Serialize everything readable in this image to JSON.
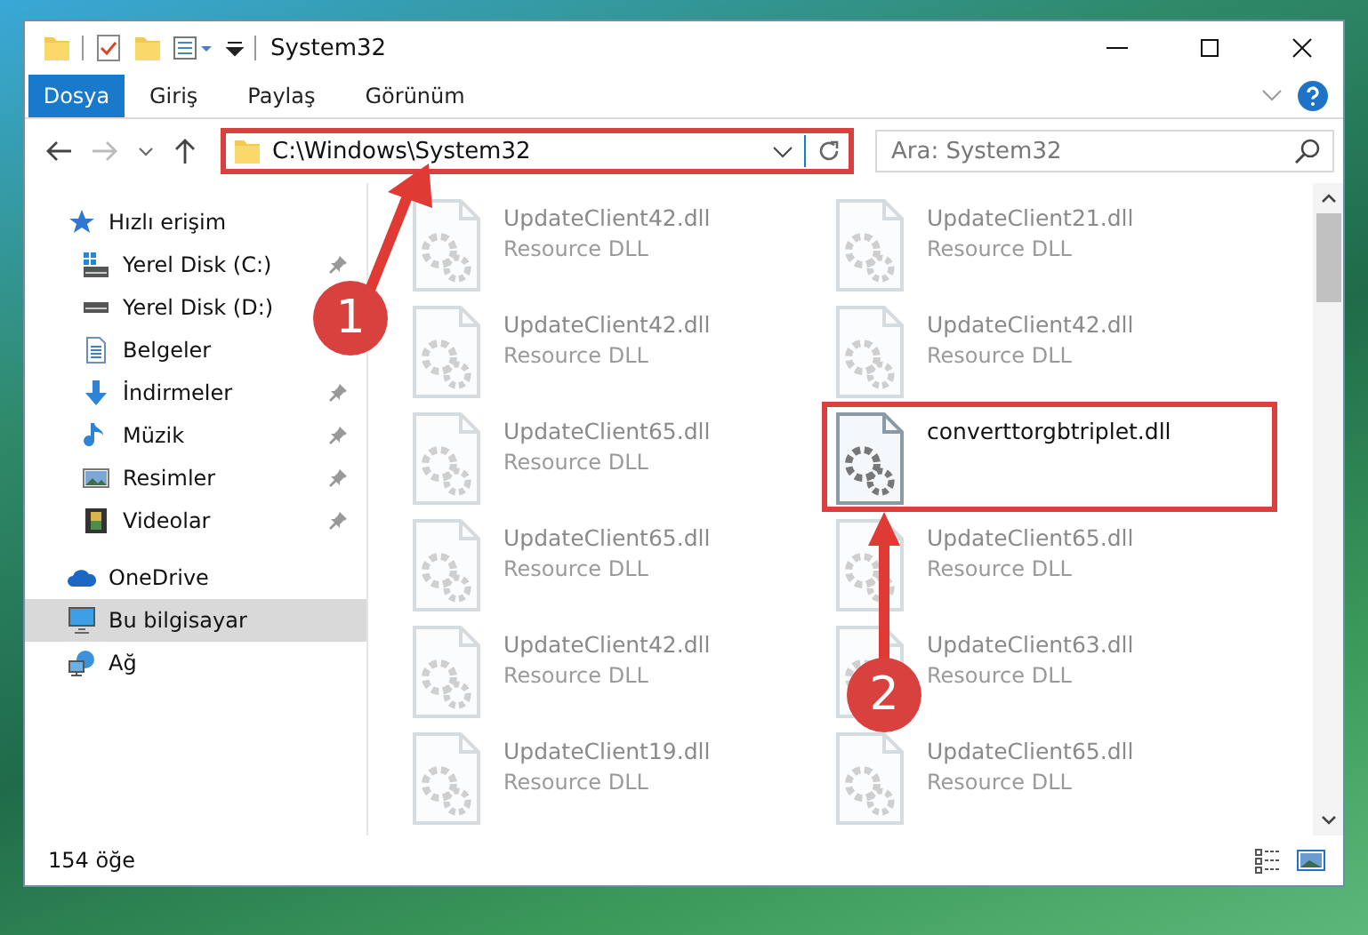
{
  "window": {
    "title": "System32"
  },
  "ribbon": {
    "tabs": [
      {
        "label": "Dosya",
        "kind": "file"
      },
      {
        "label": "Giriş",
        "kind": "tab"
      },
      {
        "label": "Paylaş",
        "kind": "tab"
      },
      {
        "label": "Görünüm",
        "kind": "tab"
      }
    ]
  },
  "address": {
    "path": "C:\\Windows\\System32",
    "highlighted": true
  },
  "search": {
    "placeholder": "Ara: System32"
  },
  "sidebar": {
    "items": [
      {
        "label": "Hızlı erişim",
        "selected": false,
        "children": [
          {
            "label": "Yerel Disk (C:)",
            "pinned": true,
            "selected": false
          },
          {
            "label": "Yerel Disk (D:)",
            "pinned": false,
            "selected": false
          },
          {
            "label": "Belgeler",
            "pinned": false,
            "selected": false
          },
          {
            "label": "İndirmeler",
            "pinned": true,
            "selected": false
          },
          {
            "label": "Müzik",
            "pinned": true,
            "selected": false
          },
          {
            "label": "Resimler",
            "pinned": true,
            "selected": false
          },
          {
            "label": "Videolar",
            "pinned": true,
            "selected": false
          }
        ]
      },
      {
        "label": "OneDrive",
        "selected": false
      },
      {
        "label": "Bu bilgisayar",
        "selected": true
      },
      {
        "label": "Ağ",
        "selected": false
      }
    ]
  },
  "files": [
    {
      "name": "UpdateClient42.dll",
      "type": "Resource DLL",
      "faded": true,
      "highlighted": false
    },
    {
      "name": "UpdateClient21.dll",
      "type": "Resource DLL",
      "faded": true,
      "highlighted": false
    },
    {
      "name": "UpdateClient42.dll",
      "type": "Resource DLL",
      "faded": true,
      "highlighted": false
    },
    {
      "name": "UpdateClient42.dll",
      "type": "Resource DLL",
      "faded": true,
      "highlighted": false
    },
    {
      "name": "UpdateClient65.dll",
      "type": "Resource DLL",
      "faded": true,
      "highlighted": false
    },
    {
      "name": "converttorgbtriplet.dll",
      "faded": false,
      "highlighted": true
    },
    {
      "name": "UpdateClient65.dll",
      "type": "Resource DLL",
      "faded": true,
      "highlighted": false
    },
    {
      "name": "UpdateClient65.dll",
      "type": "Resource DLL",
      "faded": true,
      "highlighted": false
    },
    {
      "name": "UpdateClient42.dll",
      "type": "Resource DLL",
      "faded": true,
      "highlighted": false
    },
    {
      "name": "UpdateClient63.dll",
      "type": "Resource DLL",
      "faded": true,
      "highlighted": false
    },
    {
      "name": "UpdateClient19.dll",
      "type": "Resource DLL",
      "faded": true,
      "highlighted": false
    },
    {
      "name": "UpdateClient65.dll",
      "type": "Resource DLL",
      "faded": true,
      "highlighted": false
    }
  ],
  "status_bar": {
    "count": "154 öğe"
  },
  "callouts": [
    {
      "label": "1"
    },
    {
      "label": "2"
    }
  ]
}
